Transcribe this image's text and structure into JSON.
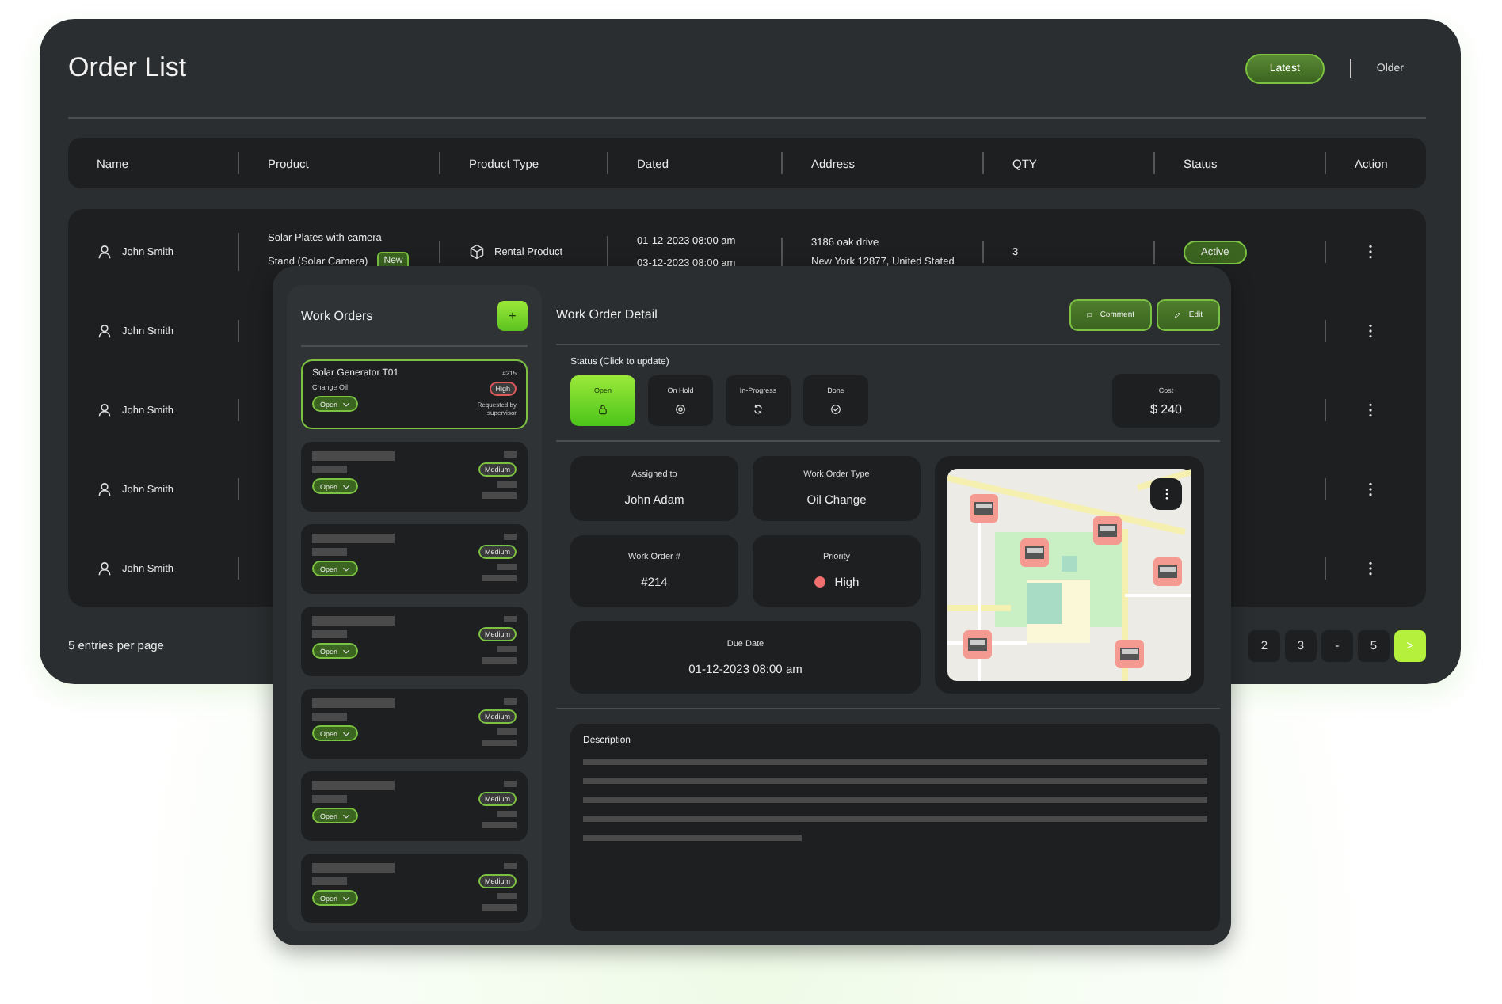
{
  "order_list": {
    "title": "Order List",
    "filters": [
      {
        "label": "Latest",
        "selected": true
      },
      {
        "label": "Older",
        "selected": false
      }
    ],
    "columns": [
      "Name",
      "Product",
      "Product Type",
      "Dated",
      "Address",
      "QTY",
      "Status",
      "Action"
    ],
    "rows": [
      {
        "name": "John Smith",
        "product": [
          "Solar Plates with camera",
          "Stand (Solar Camera)"
        ],
        "badge": "New",
        "product_type": "Rental Product",
        "dated": [
          "01-12-2023 08:00 am",
          "03-12-2023 08:00 am"
        ],
        "address": [
          "3186 oak drive",
          "New York 12877, United Stated"
        ],
        "qty": "3",
        "status": "Active"
      },
      {
        "name": "John Smith"
      },
      {
        "name": "John Smith"
      },
      {
        "name": "John Smith"
      },
      {
        "name": "John Smith"
      }
    ],
    "footer": "5 entries per page",
    "pages": [
      {
        "label": "2",
        "kind": "page"
      },
      {
        "label": "3",
        "kind": "page"
      },
      {
        "label": "-",
        "kind": "page"
      },
      {
        "label": "5",
        "kind": "page"
      },
      {
        "label": ">",
        "kind": "next"
      }
    ]
  },
  "work_orders": {
    "title": "Work Orders",
    "add_label": "+",
    "items": [
      {
        "kind": "full",
        "title": "Solar Generator T01",
        "subtitle": "Change Oil",
        "status": "Open",
        "number": "#215",
        "priority": "High",
        "color": "#e05a5a",
        "requested": "Requested by supervisor",
        "selected": true
      },
      {
        "kind": "placeholder",
        "status": "Open",
        "priority": "Medium",
        "color": "#7cc242",
        "selected": false
      },
      {
        "kind": "placeholder",
        "status": "Open",
        "priority": "Medium",
        "color": "#7cc242",
        "selected": false
      },
      {
        "kind": "placeholder",
        "status": "Open",
        "priority": "Medium",
        "color": "#7cc242",
        "selected": false
      },
      {
        "kind": "placeholder",
        "status": "Open",
        "priority": "Medium",
        "color": "#7cc242",
        "selected": false
      },
      {
        "kind": "placeholder",
        "status": "Open",
        "priority": "Medium",
        "color": "#7cc242",
        "selected": false
      },
      {
        "kind": "placeholder",
        "status": "Open",
        "priority": "Medium",
        "color": "#7cc242",
        "selected": false
      }
    ]
  },
  "detail": {
    "title": "Work Order Detail",
    "actions": [
      {
        "label": "Comment",
        "kind": "comment"
      },
      {
        "label": "Edit",
        "kind": "edit"
      }
    ],
    "status_label": "Status (Click to update)",
    "statuses": [
      {
        "label": "Open",
        "kind": "lock",
        "selected": true
      },
      {
        "label": "On Hold",
        "kind": "hold",
        "selected": false
      },
      {
        "label": "In-Progress",
        "kind": "progress",
        "selected": false
      },
      {
        "label": "Done",
        "kind": "done",
        "selected": false
      }
    ],
    "cost": {
      "label": "Cost",
      "value": "$ 240"
    },
    "fields": [
      {
        "label": "Assigned to",
        "value": "John Adam"
      },
      {
        "label": "Work Order Type",
        "value": "Oil Change"
      },
      {
        "label": "Work Order #",
        "value": "#214"
      },
      {
        "label": "Priority",
        "value": "High",
        "color": "#f07070"
      },
      {
        "label": "Due Date",
        "value": "01-12-2023 08:00 am"
      }
    ],
    "description": {
      "label": "Description"
    }
  }
}
